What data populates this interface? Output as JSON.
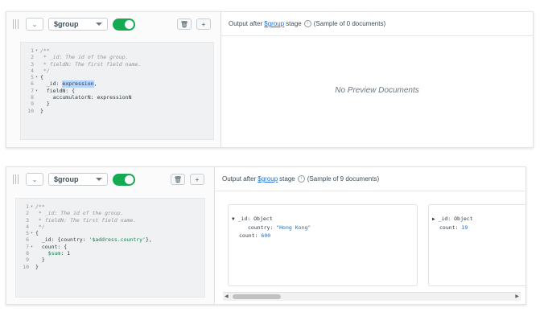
{
  "stage1": {
    "operator": "$group",
    "chevron": "⌄",
    "delete_icon": "🗑",
    "add_icon": "+",
    "output": {
      "prefix": "Output after",
      "link": "$group",
      "suffix": "stage",
      "sample": "(Sample of 0 documents)"
    },
    "empty_text": "No Preview Documents",
    "code": {
      "l1": "/**",
      "l2": " * _id: The id of the group.",
      "l3": " * fieldN: The first field name.",
      "l4": " */",
      "l5": "{",
      "l6a": "  _id: ",
      "l6b": "expression",
      "l6c": ",",
      "l7": "  fieldN: {",
      "l8": "    accumulatorN: expressionN",
      "l9": "  }",
      "l10": "}"
    }
  },
  "stage2": {
    "operator": "$group",
    "chevron": "⌄",
    "delete_icon": "🗑",
    "add_icon": "+",
    "output": {
      "prefix": "Output after",
      "link": "$group",
      "suffix": "stage",
      "sample": "(Sample of 9 documents)"
    },
    "code": {
      "l1": "/**",
      "l2": " * _id: The id of the group.",
      "l3": " * fieldN: The first field name.",
      "l4": " */",
      "l5": "{",
      "l6a": "  _id: {country: ",
      "l6b": "'$address.country'",
      "l6c": "},",
      "l7": "  count: {",
      "l8a": "    ",
      "l8b": "$sum",
      "l8c": ": 1",
      "l9": "  }",
      "l10": "}"
    },
    "doc1": {
      "id_key": "_id",
      "id_type": "Object",
      "country_key": "country",
      "country_val": "\"Hong Kong\"",
      "count_key": "count",
      "count_val": "600"
    },
    "doc2": {
      "id_key": "_id",
      "id_type": "Object",
      "count_key": "count",
      "count_val": "19"
    }
  },
  "line_numbers": [
    "1",
    "2",
    "3",
    "4",
    "5",
    "6",
    "7",
    "8",
    "9",
    "10"
  ],
  "colors": {
    "toggle_on": "#13aa52",
    "link": "#1a73e8",
    "selection": "#b5d5ff"
  }
}
